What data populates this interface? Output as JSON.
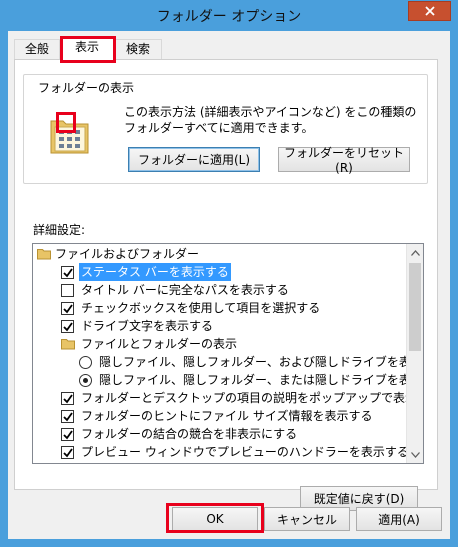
{
  "window": {
    "title": "フォルダー オプション"
  },
  "tabs": [
    {
      "label": "全般",
      "active": false
    },
    {
      "label": "表示",
      "active": true
    },
    {
      "label": "検索",
      "active": false
    }
  ],
  "folder_view": {
    "group_label": "フォルダーの表示",
    "description": "この表示方法 (詳細表示やアイコンなど) をこの種類のフォルダーすべてに適用できます。",
    "apply_button": "フォルダーに適用(L)",
    "reset_button": "フォルダーをリセット(R)"
  },
  "advanced": {
    "label": "詳細設定:",
    "items": [
      {
        "type": "folder",
        "label": "ファイルおよびフォルダー"
      },
      {
        "type": "checkbox",
        "checked": true,
        "label": "ステータス バーを表示する"
      },
      {
        "type": "checkbox",
        "checked": false,
        "label": "タイトル バーに完全なパスを表示する"
      },
      {
        "type": "checkbox",
        "checked": true,
        "label": "チェックボックスを使用して項目を選択する"
      },
      {
        "type": "checkbox",
        "checked": true,
        "label": "ドライブ文字を表示する"
      },
      {
        "type": "folder",
        "label": "ファイルとフォルダーの表示"
      },
      {
        "type": "radio",
        "selected": false,
        "label": "隠しファイル、隠しフォルダー、および隠しドライブを表示する"
      },
      {
        "type": "radio",
        "selected": true,
        "label": "隠しファイル、隠しフォルダー、または隠しドライブを表示しない"
      },
      {
        "type": "checkbox",
        "checked": true,
        "label": "フォルダーとデスクトップの項目の説明をポップアップで表示する"
      },
      {
        "type": "checkbox",
        "checked": true,
        "label": "フォルダーのヒントにファイル サイズ情報を表示する"
      },
      {
        "type": "checkbox",
        "checked": true,
        "label": "フォルダーの結合の競合を非表示にする"
      },
      {
        "type": "checkbox",
        "checked": true,
        "label": "プレビュー ウィンドウでプレビューのハンドラーを表示する"
      }
    ],
    "default_button": "既定値に戻す(D)"
  },
  "footer": {
    "ok": "OK",
    "cancel": "キャンセル",
    "apply": "適用(A)"
  }
}
